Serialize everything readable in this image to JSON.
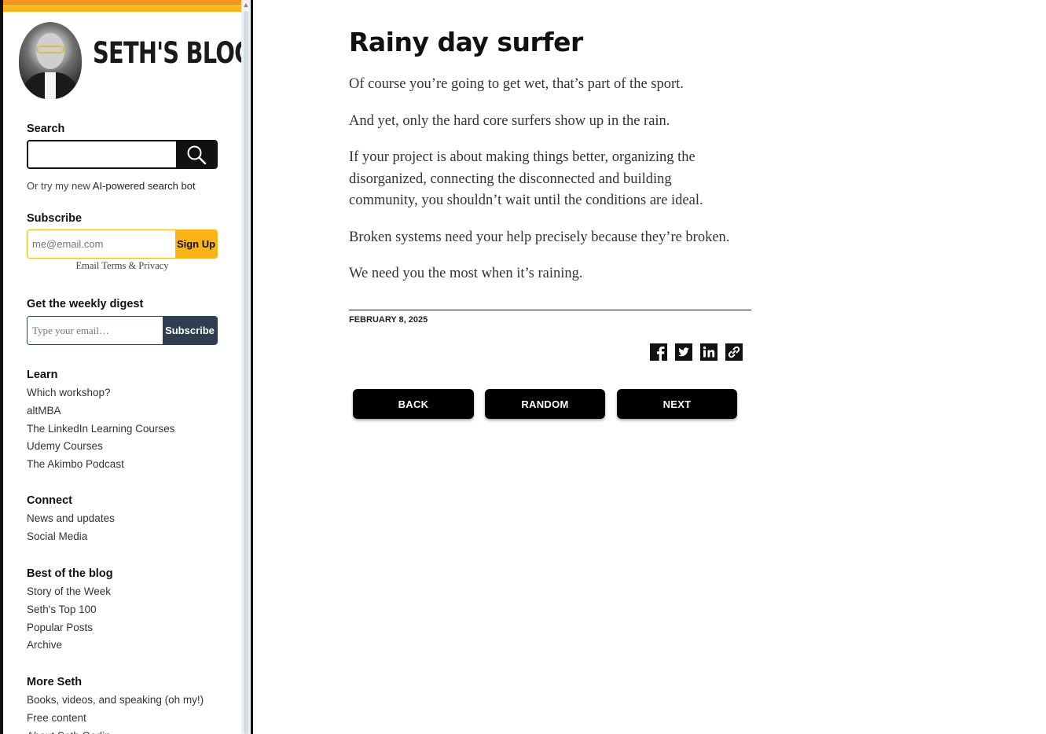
{
  "sidebar": {
    "logo_text": "SETH'S BLOG",
    "search": {
      "heading": "Search",
      "value": "",
      "placeholder": ""
    },
    "ai_search": {
      "prefix": "Or try my new ",
      "link": "AI-powered search bot"
    },
    "subscribe": {
      "heading": "Subscribe",
      "placeholder": "me@email.com",
      "button": "Sign Up",
      "terms": "Email Terms & Privacy"
    },
    "digest": {
      "heading": "Get the weekly digest",
      "placeholder": "Type your email…",
      "button": "Subscribe"
    },
    "learn": {
      "heading": "Learn",
      "items": [
        "Which workshop?",
        "altMBA",
        "The LinkedIn Learning Courses",
        "Udemy Courses",
        "The Akimbo Podcast"
      ]
    },
    "connect": {
      "heading": "Connect",
      "items": [
        "News and updates",
        "Social Media"
      ]
    },
    "best": {
      "heading": "Best of the blog",
      "items": [
        "Story of the Week",
        "Seth's Top 100",
        "Popular Posts",
        "Archive"
      ]
    },
    "more": {
      "heading": "More Seth",
      "items": [
        "Books, videos, and speaking (oh my!)",
        "Free content",
        "About Seth Godin"
      ]
    }
  },
  "post": {
    "title": "Rainy day surfer",
    "paragraphs": [
      "Of course you’re going to get wet, that’s part of the sport.",
      "And yet, only the hard core surfers show up in the rain.",
      "If your project is about making things better, organizing the disorganized, connecting the disconnected and building community, you shouldn’t wait until the conditions are ideal.",
      "Broken systems need your help precisely because they’re broken.",
      "We need you the most when it’s raining."
    ],
    "date": "FEBRUARY 8, 2025"
  },
  "share_icons": [
    "facebook-icon",
    "twitter-icon",
    "linkedin-icon",
    "link-icon"
  ],
  "nav": {
    "back": "BACK",
    "random": "RANDOM",
    "next": "NEXT"
  },
  "colors": {
    "accent_orange": "#f7941d",
    "accent_yellow": "#fcb415",
    "digest_navy": "#2c3e50"
  }
}
